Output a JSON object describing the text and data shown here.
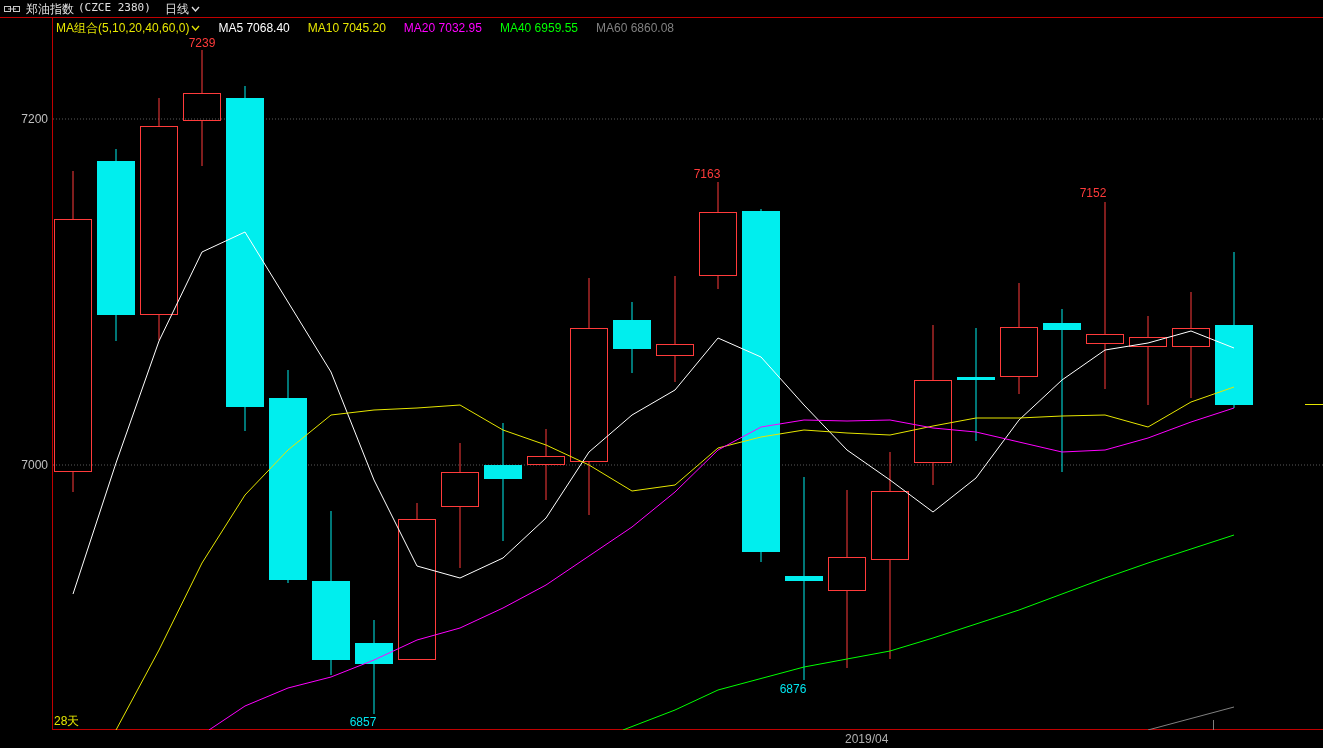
{
  "header": {
    "name": "郑油指数",
    "code": "(CZCE 2380)",
    "period": "日线"
  },
  "legend": {
    "group": "MA组合(5,10,20,40,60,0)",
    "items": [
      {
        "label": "MA5 7068.40",
        "color": "#ffffff"
      },
      {
        "label": "MA10 7045.20",
        "color": "#e6e600"
      },
      {
        "label": "MA20 7032.95",
        "color": "#ff00ff"
      },
      {
        "label": "MA40 6959.55",
        "color": "#00ff00"
      },
      {
        "label": "MA60 6860.08",
        "color": "#808080"
      }
    ]
  },
  "price_axis": [
    "7200",
    "7000"
  ],
  "price_marks": [
    {
      "text": "7239",
      "kind": "high"
    },
    {
      "text": "7163",
      "kind": "high"
    },
    {
      "text": "7152",
      "kind": "high"
    },
    {
      "text": "6857",
      "kind": "low"
    },
    {
      "text": "6876",
      "kind": "low"
    }
  ],
  "bar_count": "28天",
  "date_label": "2019/04"
}
